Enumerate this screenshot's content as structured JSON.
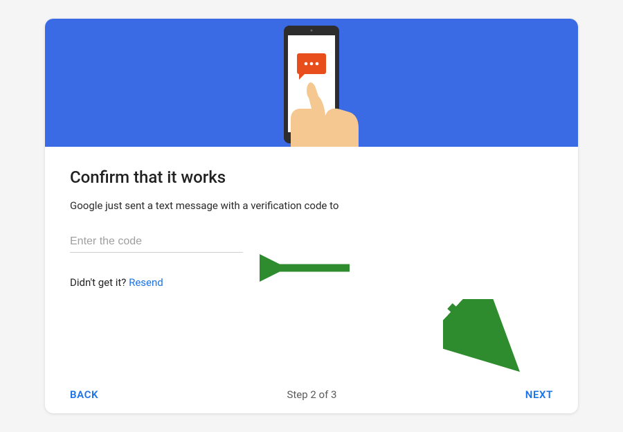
{
  "banner": {
    "icon": "phone-with-sms"
  },
  "main": {
    "heading": "Confirm that it works",
    "description": "Google just sent a text message with a verification code to",
    "code_input_placeholder": "Enter the code",
    "code_input_value": "",
    "resend_prompt": "Didn't get it? ",
    "resend_link_label": "Resend"
  },
  "footer": {
    "back_label": "BACK",
    "step_label": "Step 2 of 3",
    "next_label": "NEXT"
  },
  "annotations": {
    "arrow_color": "#2e8b2e"
  }
}
